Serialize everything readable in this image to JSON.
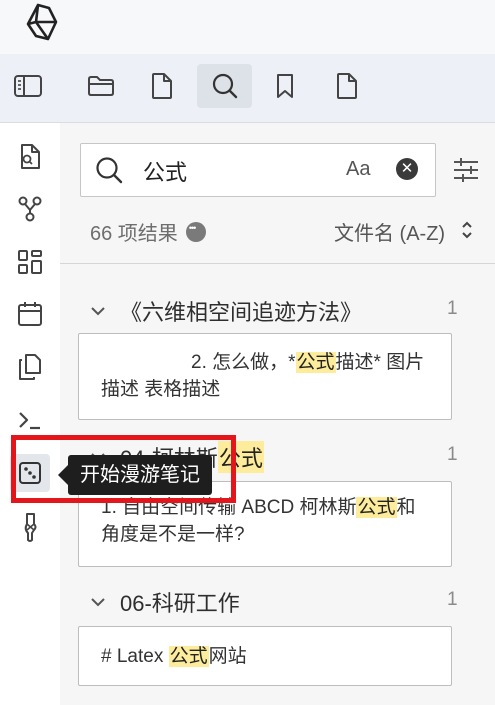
{
  "tabs": [
    "sidebar-toggle",
    "files",
    "file",
    "search",
    "bookmarks",
    "file"
  ],
  "ribbon": [
    "quick-switcher",
    "graph-view",
    "canvas",
    "daily-note",
    "templates",
    "command-palette",
    "random-note",
    "audio-recorder"
  ],
  "search": {
    "query": "公式",
    "match_case_label": "Aa",
    "clear_glyph": "✕",
    "results_count": "66 项结果",
    "sort_label": "文件名 (A-Z)"
  },
  "groups": [
    {
      "title": "《六维相空间追迹方法》",
      "count": "1",
      "snippet": {
        "before": "2. 怎么做，*",
        "match": "公式",
        "after": "描述*  图片描述 表格描述"
      }
    },
    {
      "title_before": "04-柯林斯",
      "title_match": "公式",
      "count": "1",
      "snippet": {
        "before": "1. 自由空间传输 ABCD 柯林斯",
        "match": "公式",
        "after": "和角度是不是一样?"
      }
    },
    {
      "title": "06-科研工作",
      "count": "1",
      "snippet": {
        "before": "# Latex ",
        "match": "公式",
        "after": "网站"
      }
    }
  ],
  "tooltip": "开始漫游笔记",
  "colors": {
    "highlight": "#fdec9c",
    "annotation": "#e3161b",
    "tooltip_bg": "#1e1e1e"
  }
}
